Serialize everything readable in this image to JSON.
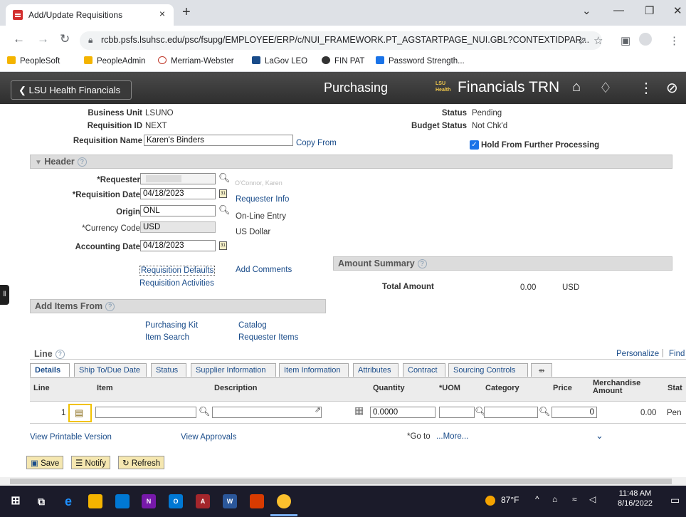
{
  "browser": {
    "tab_title": "Add/Update Requisitions",
    "tab_close": "×",
    "new_tab": "+",
    "url": "rcbb.psfs.lsuhsc.edu/psc/fsupg/EMPLOYEE/ERP/c/NUI_FRAMEWORK.PT_AGSTARTPAGE_NUI.GBL?CONTEXTIDPAR...",
    "bookmarks": [
      {
        "label": "PeopleSoft",
        "color": "#f4b400"
      },
      {
        "label": "PeopleAdmin",
        "color": "#f4b400"
      },
      {
        "label": "Merriam-Webster",
        "color": "#c0392b"
      },
      {
        "label": "LaGov LEO",
        "color": "#1a4c8a"
      },
      {
        "label": "FIN PAT",
        "color": "#333333"
      },
      {
        "label": "Password Strength...",
        "color": "#1a73e8"
      }
    ]
  },
  "header": {
    "back_label": "LSU Health Financials",
    "title": "Purchasing",
    "logo_text": "LSU Health",
    "app_name": "Financials TRN"
  },
  "form": {
    "business_unit_label": "Business Unit",
    "business_unit": "LSUNO",
    "requisition_id_label": "Requisition ID",
    "requisition_id": "NEXT",
    "requisition_name_label": "Requisition Name",
    "requisition_name": "Karen's Binders",
    "copy_from": "Copy From",
    "status_label": "Status",
    "status": "Pending",
    "budget_status_label": "Budget Status",
    "budget_status": "Not Chk'd",
    "hold_label": "Hold From Further Processing"
  },
  "header_section": {
    "title": "Header",
    "requester_label": "*Requester",
    "requester_value": "",
    "requester_name": "O'Connor, Karen",
    "req_date_label": "*Requisition Date",
    "req_date": "04/18/2023",
    "requester_info": "Requester Info",
    "origin_label": "Origin",
    "origin": "ONL",
    "origin_desc": "On-Line Entry",
    "currency_label": "*Currency Code",
    "currency": "USD",
    "currency_desc": "US Dollar",
    "acct_date_label": "Accounting Date",
    "acct_date": "04/18/2023",
    "req_defaults": "Requisition Defaults",
    "add_comments": "Add Comments",
    "req_activities": "Requisition Activities"
  },
  "amount_summary": {
    "title": "Amount Summary",
    "total_label": "Total Amount",
    "total": "0.00",
    "currency": "USD"
  },
  "add_items": {
    "title": "Add Items From",
    "purchasing_kit": "Purchasing Kit",
    "catalog": "Catalog",
    "item_search": "Item Search",
    "requester_items": "Requester Items"
  },
  "line": {
    "title": "Line",
    "personalize": "Personalize",
    "sep": "|",
    "find": "Find",
    "tabs": [
      "Details",
      "Ship To/Due Date",
      "Status",
      "Supplier Information",
      "Item Information",
      "Attributes",
      "Contract",
      "Sourcing Controls"
    ],
    "columns": {
      "line": "Line",
      "item": "Item",
      "description": "Description",
      "quantity": "Quantity",
      "uom": "*UOM",
      "category": "Category",
      "price": "Price",
      "merch": "Merchandise Amount",
      "status": "Stat"
    },
    "row": {
      "line": "1",
      "quantity": "0.0000",
      "price": "0",
      "merch": "0.00",
      "status": "Pen"
    }
  },
  "footer": {
    "printable": "View Printable Version",
    "approvals": "View Approvals",
    "goto": "*Go to",
    "more": "...More...",
    "save": "Save",
    "notify": "Notify",
    "refresh": "Refresh"
  },
  "taskbar": {
    "temp": "87°F",
    "time": "11:48 AM",
    "date": "8/16/2022"
  }
}
